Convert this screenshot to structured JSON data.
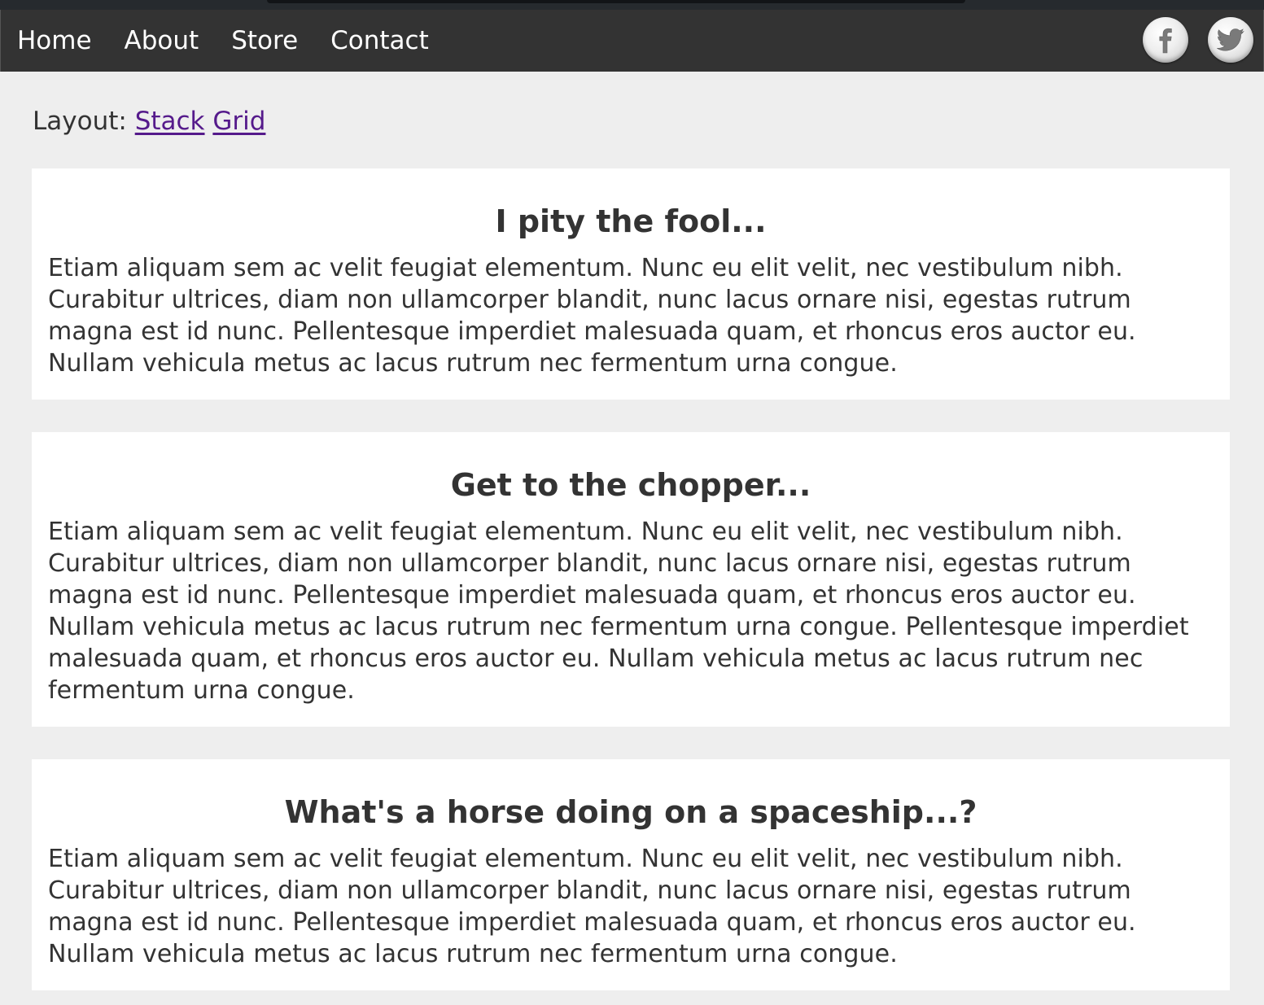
{
  "nav": {
    "links": [
      {
        "label": "Home"
      },
      {
        "label": "About"
      },
      {
        "label": "Store"
      },
      {
        "label": "Contact"
      }
    ],
    "social": [
      {
        "icon": "facebook-icon"
      },
      {
        "icon": "twitter-icon"
      }
    ]
  },
  "layout": {
    "label": "Layout:",
    "options": [
      "Stack",
      "Grid"
    ]
  },
  "cards": [
    {
      "title": "I pity the fool...",
      "body": "Etiam aliquam sem ac velit feugiat elementum. Nunc eu elit velit, nec vestibulum nibh. Curabitur ultrices, diam non ullamcorper blandit, nunc lacus ornare nisi, egestas rutrum magna est id nunc. Pellentesque imperdiet malesuada quam, et rhoncus eros auctor eu. Nullam vehicula metus ac lacus rutrum nec fermentum urna congue."
    },
    {
      "title": "Get to the chopper...",
      "body": "Etiam aliquam sem ac velit feugiat elementum. Nunc eu elit velit, nec vestibulum nibh. Curabitur ultrices, diam non ullamcorper blandit, nunc lacus ornare nisi, egestas rutrum magna est id nunc. Pellentesque imperdiet malesuada quam, et rhoncus eros auctor eu. Nullam vehicula metus ac lacus rutrum nec fermentum urna congue. Pellentesque imperdiet malesuada quam, et rhoncus eros auctor eu. Nullam vehicula metus ac lacus rutrum nec fermentum urna congue."
    },
    {
      "title": "What's a horse doing on a spaceship...?",
      "body": "Etiam aliquam sem ac velit feugiat elementum. Nunc eu elit velit, nec vestibulum nibh. Curabitur ultrices, diam non ullamcorper blandit, nunc lacus ornare nisi, egestas rutrum magna est id nunc. Pellentesque imperdiet malesuada quam, et rhoncus eros auctor eu. Nullam vehicula metus ac lacus rutrum nec fermentum urna congue."
    }
  ],
  "colors": {
    "navbar": "#333333",
    "page_background": "#eeeeee",
    "card_background": "#ffffff",
    "text": "#333333",
    "visited_link": "#551a8b"
  }
}
